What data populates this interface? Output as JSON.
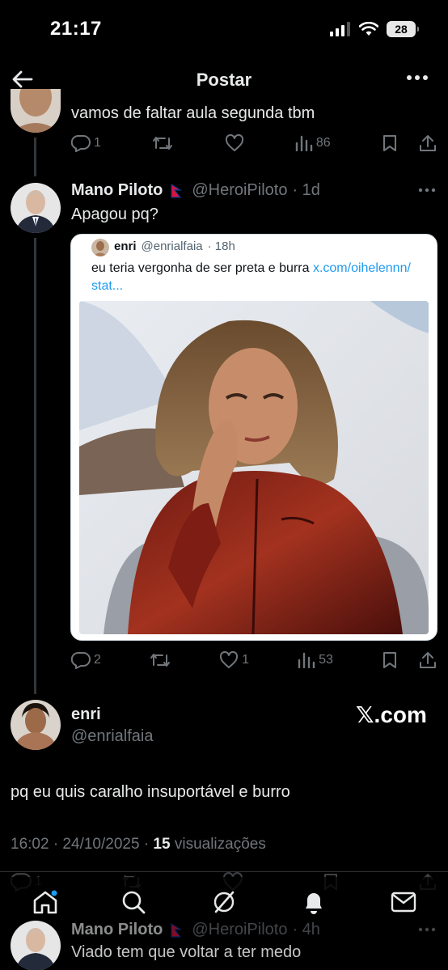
{
  "status_bar": {
    "time": "21:17",
    "battery": "28"
  },
  "header": {
    "title": "Postar"
  },
  "reply_top": {
    "text": "vamos de faltar aula segunda tbm",
    "replies": "1",
    "views": "86"
  },
  "reply_mano": {
    "name": "Mano Piloto",
    "handle": "@HeroiPiloto",
    "time": "· 1d",
    "text": "Apagou pq?",
    "quote": {
      "name": "enri",
      "handle": "@enrialfaia",
      "time": "· 18h",
      "text": "eu teria vergonha de ser preta e burra",
      "link": "x.com/oihelennn/",
      "link2": "stat..."
    },
    "replies": "2",
    "likes": "1",
    "views": "53"
  },
  "main_post": {
    "name": "enri",
    "handle": "@enrialfaia",
    "watermark": "𝕏.com",
    "text": "pq eu quis caralho insuportável e burro",
    "timestamp": "16:02 · 24/10/2025 · ",
    "views_count": "15",
    "views_label": " visualizações"
  },
  "reply_bottom": {
    "name": "Mano Piloto",
    "handle": "@HeroiPiloto",
    "time": "· 4h",
    "text": "Viado tem que voltar a ter medo",
    "partial_replies": "1"
  },
  "icons": {
    "back": "arrow-left-icon",
    "more": "more-horizontal-icon",
    "reply": "reply-icon",
    "repost": "repost-icon",
    "like": "heart-icon",
    "views": "views-icon",
    "bookmark": "bookmark-icon",
    "share": "share-icon",
    "nav": [
      "home-icon",
      "search-icon",
      "grok-icon",
      "notifications-icon",
      "messages-icon"
    ]
  },
  "colors": {
    "background": "#000000",
    "text": "#e7e9ea",
    "muted": "#71767b",
    "link": "#1d9bf0",
    "notif_dot": "#1d9bf0"
  }
}
